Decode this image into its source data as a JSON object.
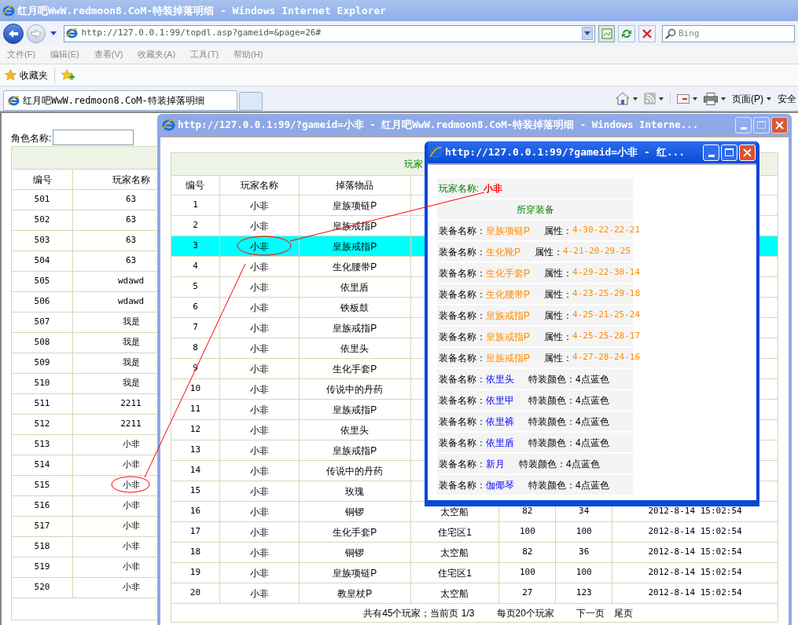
{
  "browser": {
    "title": "红月吧WwW.redmoon8.CoM-特装掉落明细 - Windows Internet Explorer",
    "address": "http://127.0.0.1:99/topdl.asp?gameid=&page=26#",
    "search_placeholder": "Bing",
    "menu": [
      "文件(F)",
      "编辑(E)",
      "查看(V)",
      "收藏夹(A)",
      "工具(T)",
      "帮助(H)"
    ],
    "favorites_label": "收藏夹",
    "tabs": [
      {
        "label": "红月吧WwW.redmoon8.CoM-特装掉落明细",
        "selected": true
      }
    ],
    "commands": [
      "页面(P)",
      "安全"
    ]
  },
  "left_page": {
    "search_label": "角色名称:",
    "columns": [
      "编号",
      "玩家名称"
    ],
    "rows": [
      [
        "501",
        "63"
      ],
      [
        "502",
        "63"
      ],
      [
        "503",
        "63"
      ],
      [
        "504",
        "63"
      ],
      [
        "505",
        "wdawd"
      ],
      [
        "506",
        "wdawd"
      ],
      [
        "507",
        "我是"
      ],
      [
        "508",
        "我是"
      ],
      [
        "509",
        "我是"
      ],
      [
        "510",
        "我是"
      ],
      [
        "511",
        "2211"
      ],
      [
        "512",
        "2211"
      ],
      [
        "513",
        "小非"
      ],
      [
        "514",
        "小非"
      ],
      [
        "515",
        "小非"
      ],
      [
        "516",
        "小非"
      ],
      [
        "517",
        "小非"
      ],
      [
        "518",
        "小非"
      ],
      [
        "519",
        "小非"
      ],
      [
        "520",
        "小非"
      ]
    ]
  },
  "drop_window": {
    "title": "http://127.0.0.1:99/?gameid=小非 - 红月吧WwW.redmoon8.CoM-特装掉落明细 - Windows Interne...",
    "table_title": "玩家",
    "columns": [
      "编号",
      "玩家名称",
      "掉落物品"
    ],
    "rows": [
      {
        "cells": [
          "1",
          "小非",
          "皇族项链P"
        ],
        "selected": false
      },
      {
        "cells": [
          "2",
          "小非",
          "皇族戒指P"
        ],
        "selected": false
      },
      {
        "cells": [
          "3",
          "小非",
          "皇族戒指P"
        ],
        "selected": true
      },
      {
        "cells": [
          "4",
          "小非",
          "生化腰带P"
        ],
        "selected": false
      },
      {
        "cells": [
          "5",
          "小非",
          "依里盾"
        ],
        "selected": false
      },
      {
        "cells": [
          "6",
          "小非",
          "铁板鼓"
        ],
        "selected": false
      },
      {
        "cells": [
          "7",
          "小非",
          "皇族戒指P"
        ],
        "selected": false
      },
      {
        "cells": [
          "8",
          "小非",
          "依里头"
        ],
        "selected": false
      },
      {
        "cells": [
          "9",
          "小非",
          "生化手套P"
        ],
        "selected": false
      },
      {
        "cells": [
          "10",
          "小非",
          "传说中的丹药"
        ],
        "selected": false
      },
      {
        "cells": [
          "11",
          "小非",
          "皇族戒指P"
        ],
        "selected": false
      },
      {
        "cells": [
          "12",
          "小非",
          "依里头"
        ],
        "selected": false
      },
      {
        "cells": [
          "13",
          "小非",
          "皇族戒指P"
        ],
        "selected": false
      },
      {
        "cells": [
          "14",
          "小非",
          "传说中的丹药"
        ],
        "selected": false
      },
      {
        "cells": [
          "15",
          "小非",
          "玫瑰"
        ],
        "selected": false
      },
      {
        "cells": [
          "16",
          "小非",
          "铜锣",
          "太空船",
          "82",
          "34",
          "2012-8-14 15:02:54"
        ],
        "selected": false
      },
      {
        "cells": [
          "17",
          "小非",
          "生化手套P",
          "住宅区1",
          "100",
          "100",
          "2012-8-14 15:02:54"
        ],
        "selected": false
      },
      {
        "cells": [
          "18",
          "小非",
          "铜锣",
          "太空船",
          "82",
          "36",
          "2012-8-14 15:02:54"
        ],
        "selected": false
      },
      {
        "cells": [
          "19",
          "小非",
          "皇族项链P",
          "住宅区1",
          "100",
          "100",
          "2012-8-14 15:02:54"
        ],
        "selected": false
      },
      {
        "cells": [
          "20",
          "小非",
          "教皇杖P",
          "太空船",
          "27",
          "123",
          "2012-8-14 15:02:54"
        ],
        "selected": false
      }
    ],
    "footer": {
      "summary": "共有45个玩家；当前页 1/3",
      "per_page": "每页20个玩家",
      "links": [
        "下一页",
        "尾页"
      ]
    }
  },
  "popup": {
    "title": "http://127.0.0.1:99/?gameid=小非 - 红...",
    "player_label": "玩家名称:",
    "player_name": "小非",
    "section": "所穿装备",
    "items": [
      {
        "kind": "attr",
        "label": "装备名称：",
        "name": "皇族项链P",
        "prop_label": "属性：",
        "value": "4-30-22-22-21"
      },
      {
        "kind": "attr",
        "label": "装备名称：",
        "name": "生化靴P",
        "prop_label": "属性：",
        "value": "4-21-20-29-25"
      },
      {
        "kind": "attr",
        "label": "装备名称：",
        "name": "生化手套P",
        "prop_label": "属性：",
        "value": "4-29-22-30-14"
      },
      {
        "kind": "attr",
        "label": "装备名称：",
        "name": "生化腰带P",
        "prop_label": "属性：",
        "value": "4-23-25-29-18"
      },
      {
        "kind": "attr",
        "label": "装备名称：",
        "name": "皇族戒指P",
        "prop_label": "属性：",
        "value": "4-25-21-25-24"
      },
      {
        "kind": "attr",
        "label": "装备名称：",
        "name": "皇族戒指P",
        "prop_label": "属性：",
        "value": "4-25-25-28-17"
      },
      {
        "kind": "attr",
        "label": "装备名称：",
        "name": "皇族戒指P",
        "prop_label": "属性：",
        "value": "4-27-28-24-16"
      },
      {
        "kind": "special",
        "label": "装备名称：",
        "name": "依里头",
        "prop_label": "特装颜色：",
        "value": "4点蓝色"
      },
      {
        "kind": "special",
        "label": "装备名称：",
        "name": "依里甲",
        "prop_label": "特装颜色：",
        "value": "4点蓝色"
      },
      {
        "kind": "special",
        "label": "装备名称：",
        "name": "依里裤",
        "prop_label": "特装颜色：",
        "value": "4点蓝色"
      },
      {
        "kind": "special",
        "label": "装备名称：",
        "name": "依里盾",
        "prop_label": "特装颜色：",
        "value": "4点蓝色"
      },
      {
        "kind": "special",
        "label": "装备名称：",
        "name": "新月",
        "prop_label": "特装颜色：",
        "value": "4点蓝色"
      },
      {
        "kind": "special",
        "label": "装备名称：",
        "name": "伽倻琴",
        "prop_label": "特装颜色：",
        "value": "4点蓝色"
      }
    ]
  }
}
